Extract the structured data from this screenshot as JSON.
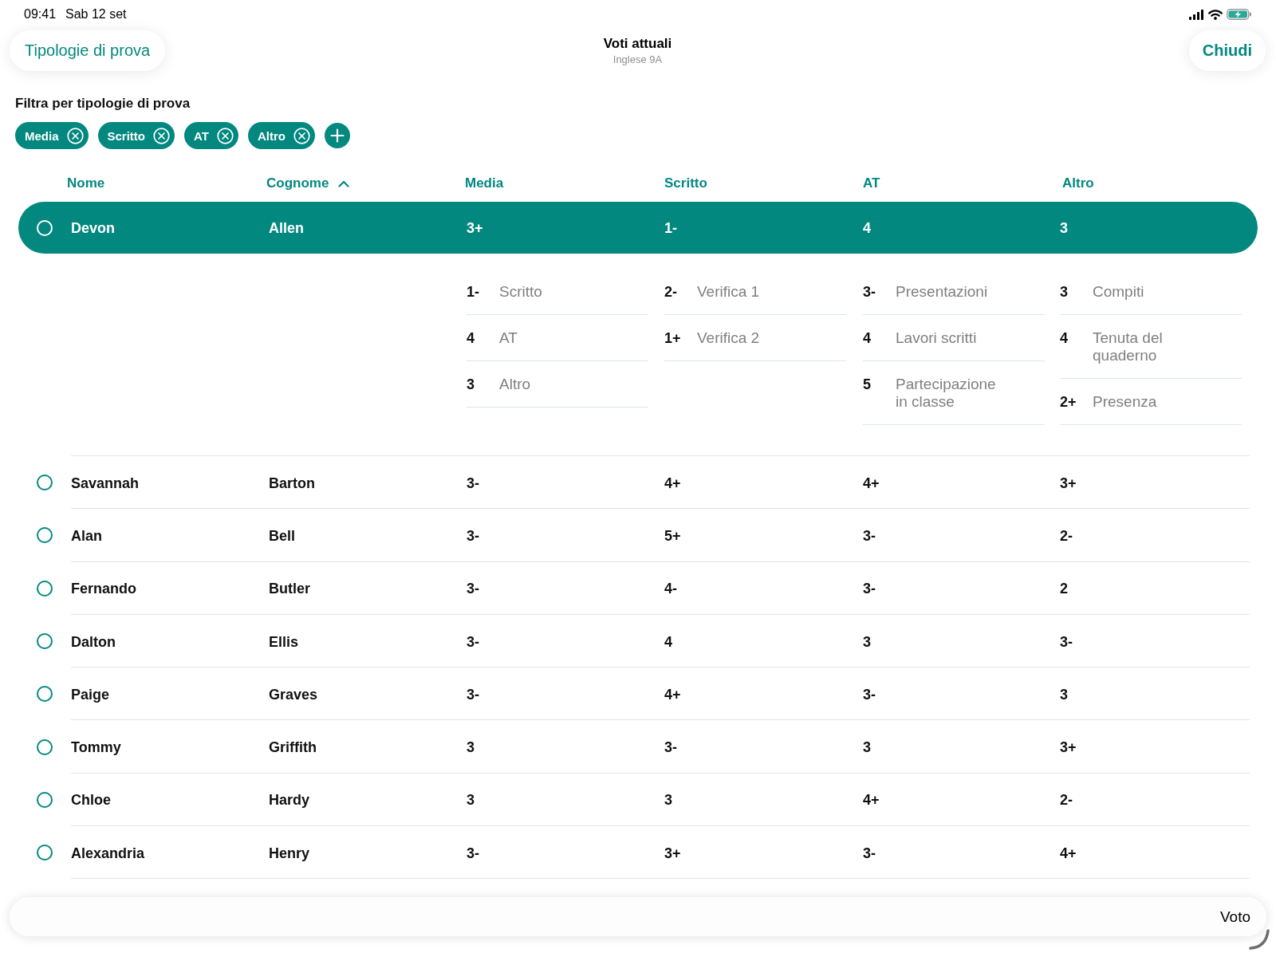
{
  "status_bar": {
    "time": "09:41",
    "date": "Sab 12 set"
  },
  "nav": {
    "back_button": "Tipologie di prova",
    "title": "Voti attuali",
    "subtitle": "Inglese 9A",
    "close_button": "Chiudi"
  },
  "filter": {
    "label": "Filtra per tipologie di prova",
    "chips": [
      {
        "label": "Media"
      },
      {
        "label": "Scritto"
      },
      {
        "label": "AT"
      },
      {
        "label": "Altro"
      }
    ]
  },
  "table": {
    "columns": [
      {
        "label": "Nome",
        "sorted": false
      },
      {
        "label": "Cognome",
        "sorted": true
      },
      {
        "label": "Media",
        "sorted": false
      },
      {
        "label": "Scritto",
        "sorted": false
      },
      {
        "label": "AT",
        "sorted": false
      },
      {
        "label": "Altro",
        "sorted": false
      }
    ],
    "rows": [
      {
        "first_name": "Devon",
        "last_name": "Allen",
        "grades": [
          "3+",
          "1-",
          "4",
          "3"
        ],
        "selected": true,
        "details": [
          [
            {
              "grade": "1-",
              "label": "Scritto"
            },
            {
              "grade": "4",
              "label": "AT"
            },
            {
              "grade": "3",
              "label": "Altro"
            }
          ],
          [
            {
              "grade": "2-",
              "label": "Verifica 1"
            },
            {
              "grade": "1+",
              "label": "Verifica 2"
            }
          ],
          [
            {
              "grade": "3-",
              "label": "Presentazioni"
            },
            {
              "grade": "4",
              "label": "Lavori scritti"
            },
            {
              "grade": "5",
              "label": "Partecipazione in classe"
            }
          ],
          [
            {
              "grade": "3",
              "label": "Compiti"
            },
            {
              "grade": "4",
              "label": "Tenuta del quaderno"
            },
            {
              "grade": "2+",
              "label": "Presenza"
            }
          ]
        ]
      },
      {
        "first_name": "Savannah",
        "last_name": "Barton",
        "grades": [
          "3-",
          "4+",
          "4+",
          "3+"
        ],
        "selected": false
      },
      {
        "first_name": "Alan",
        "last_name": "Bell",
        "grades": [
          "3-",
          "5+",
          "3-",
          "2-"
        ],
        "selected": false
      },
      {
        "first_name": "Fernando",
        "last_name": "Butler",
        "grades": [
          "3-",
          "4-",
          "3-",
          "2"
        ],
        "selected": false
      },
      {
        "first_name": "Dalton",
        "last_name": "Ellis",
        "grades": [
          "3-",
          "4",
          "3",
          "3-"
        ],
        "selected": false
      },
      {
        "first_name": "Paige",
        "last_name": "Graves",
        "grades": [
          "3-",
          "4+",
          "3-",
          "3"
        ],
        "selected": false
      },
      {
        "first_name": "Tommy",
        "last_name": "Griffith",
        "grades": [
          "3",
          "3-",
          "3",
          "3+"
        ],
        "selected": false
      },
      {
        "first_name": "Chloe",
        "last_name": "Hardy",
        "grades": [
          "3",
          "3",
          "4+",
          "2-"
        ],
        "selected": false
      },
      {
        "first_name": "Alexandria",
        "last_name": "Henry",
        "grades": [
          "3-",
          "3+",
          "3-",
          "4+"
        ],
        "selected": false
      }
    ]
  },
  "bottom_bar": {
    "label": "Voto"
  }
}
